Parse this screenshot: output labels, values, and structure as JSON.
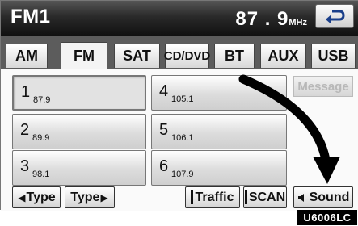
{
  "header": {
    "title": "FM1",
    "frequency": "87 . 9",
    "unit": "MHz",
    "back_icon": "return-arrow-icon"
  },
  "tabs": [
    {
      "label": "AM",
      "active": false
    },
    {
      "label": "FM",
      "active": true
    },
    {
      "label": "SAT",
      "active": false
    },
    {
      "label": "CD/DVD",
      "active": false
    },
    {
      "label": "BT",
      "active": false
    },
    {
      "label": "AUX",
      "active": false
    },
    {
      "label": "USB",
      "active": false
    }
  ],
  "presets": [
    {
      "number": "1",
      "frequency": "87.9",
      "selected": true
    },
    {
      "number": "2",
      "frequency": "89.9",
      "selected": false
    },
    {
      "number": "3",
      "frequency": "98.1",
      "selected": false
    },
    {
      "number": "4",
      "frequency": "105.1",
      "selected": false
    },
    {
      "number": "5",
      "frequency": "106.1",
      "selected": false
    },
    {
      "number": "6",
      "frequency": "107.9",
      "selected": false
    }
  ],
  "message_button": {
    "label": "Message",
    "enabled": false
  },
  "bottom": {
    "type_prev": "Type",
    "type_next": "Type",
    "traffic": "Traffic",
    "scan": "SCAN",
    "sound": "Sound"
  },
  "figure_code": "U6006LC"
}
